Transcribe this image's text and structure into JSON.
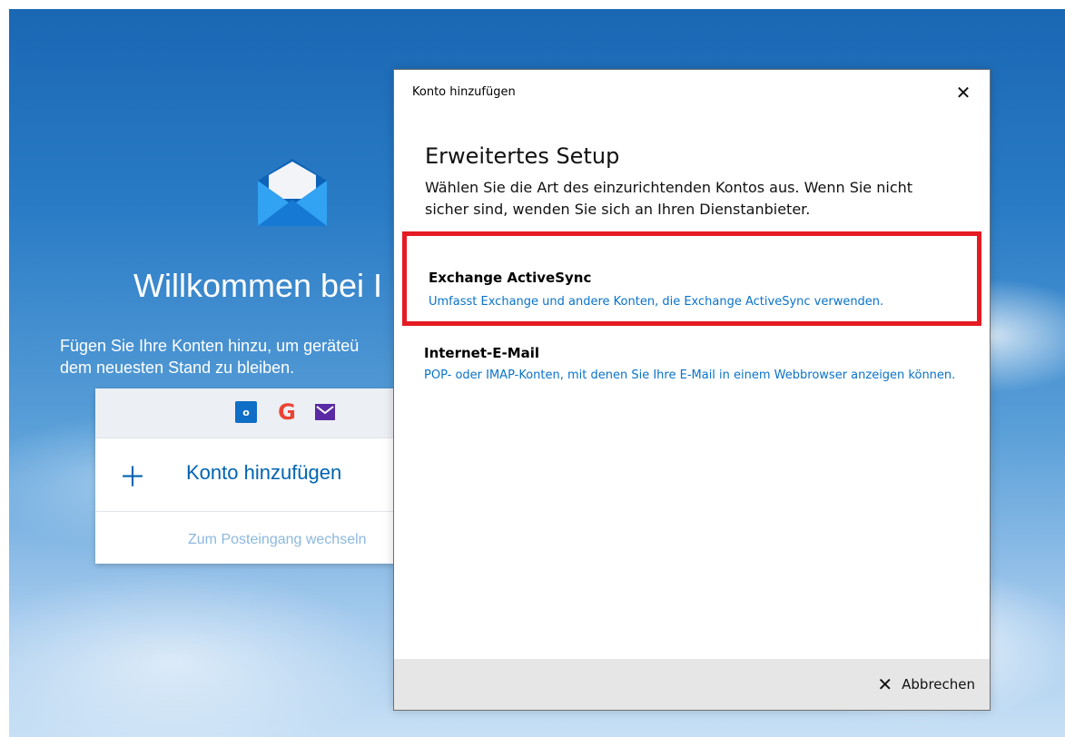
{
  "app": {
    "welcome_title": "Willkommen bei I",
    "welcome_text": "Fügen Sie Ihre Konten hinzu, um geräteü\ndem neuesten Stand zu bleiben.",
    "card": {
      "provider_icons": [
        "outlook-icon",
        "google-icon",
        "mail-icon"
      ],
      "add_account_label": "Konto hinzufügen",
      "inbox_link": "Zum Posteingang wechseln"
    }
  },
  "dialog": {
    "title": "Konto hinzufügen",
    "close_symbol": "✕",
    "heading": "Erweitertes Setup",
    "description": "Wählen Sie die Art des einzurichtenden Kontos aus. Wenn Sie nicht sicher sind, wenden Sie sich an Ihren Dienstanbieter.",
    "options": [
      {
        "title": "Exchange ActiveSync",
        "description": "Umfasst Exchange und andere Konten, die Exchange ActiveSync verwenden."
      },
      {
        "title": "Internet-E-Mail",
        "description": "POP- oder IMAP-Konten, mit denen Sie Ihre E-Mail in einem Webbrowser anzeigen können."
      }
    ],
    "footer": {
      "cancel_symbol": "✕",
      "cancel_label": "Abbrechen"
    }
  },
  "colors": {
    "accent_blue": "#0a73c9",
    "highlight_red": "#e51b23",
    "dialog_footer": "#e6e6e6"
  }
}
